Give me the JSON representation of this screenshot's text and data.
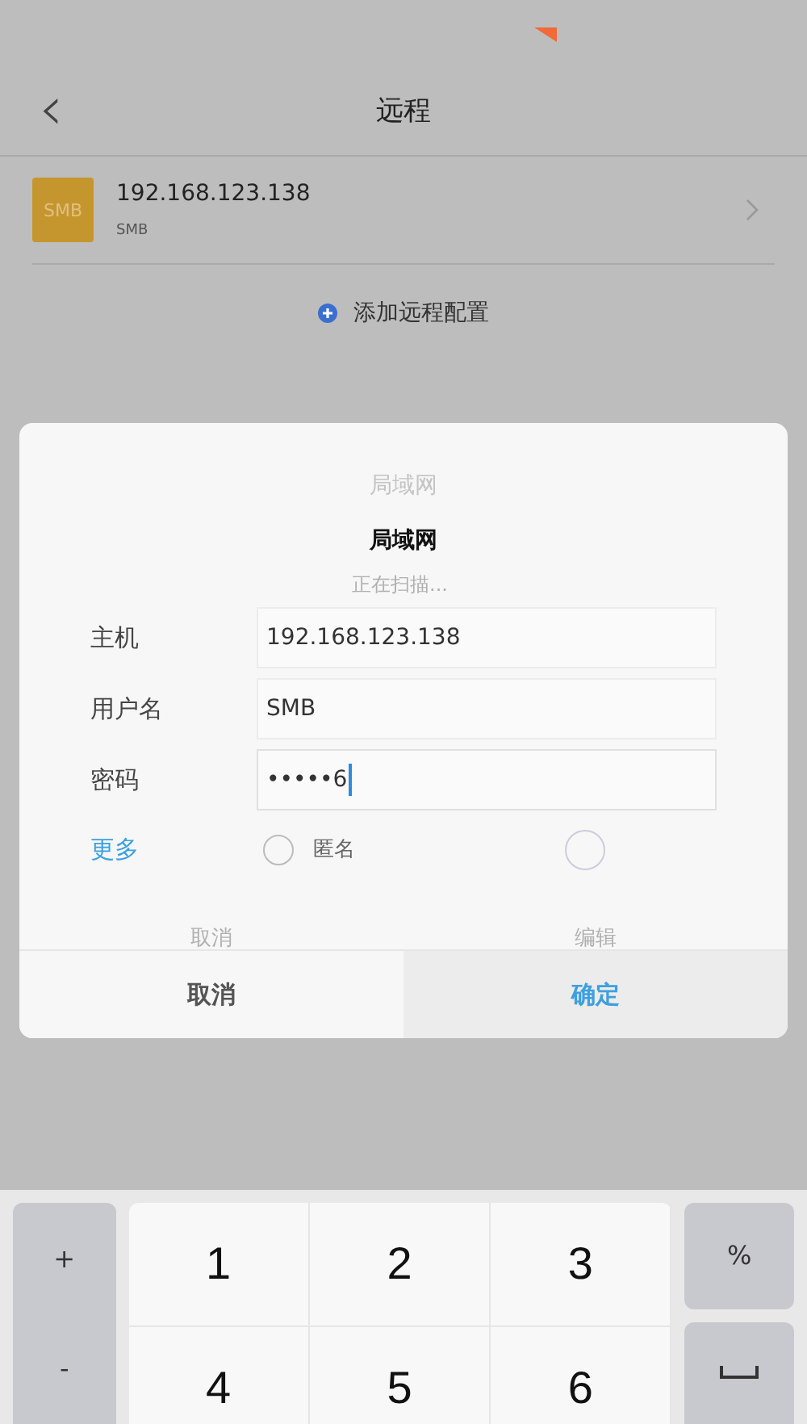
{
  "header": {
    "back": "‹",
    "title": "远程"
  },
  "remotes": [
    {
      "icon_label": "SMB",
      "address": "192.168.123.138",
      "protocol": "SMB"
    }
  ],
  "add_remote": "添加远程配置",
  "dialog": {
    "ghost_title": "局域网",
    "title": "局域网",
    "ghost_status": "正在扫描...",
    "fields": [
      {
        "label": "主机",
        "value": "192.168.123.138",
        "focused": false
      },
      {
        "label": "用户名",
        "value": "SMB",
        "focused": false
      },
      {
        "label": "密码",
        "value": "•••••6",
        "focused": true
      }
    ],
    "more": "更多",
    "options": [
      {
        "label": "匿名",
        "selected": false
      },
      {
        "selected": false
      }
    ],
    "ghost_buttons": [
      "取消",
      "编辑"
    ],
    "buttons": [
      {
        "label": "取消",
        "kind": "cancel"
      },
      {
        "label": "确定",
        "kind": "confirm"
      }
    ]
  },
  "keyboard": {
    "left_keys": [
      "+",
      "-"
    ],
    "digits": [
      "1",
      "2",
      "3",
      "4",
      "5",
      "6"
    ],
    "right_keys": [
      {
        "label": "%",
        "kind": "text"
      },
      {
        "kind": "space"
      }
    ]
  }
}
